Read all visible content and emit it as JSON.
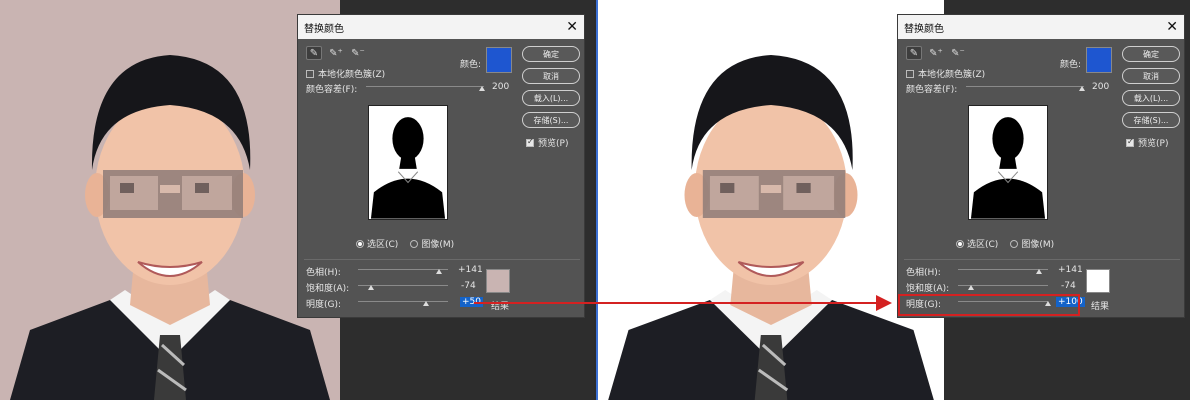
{
  "dialog": {
    "title": "替换颜色",
    "localized_label": "本地化颜色簇(Z)",
    "color_label": "颜色:",
    "fuzziness_label": "颜色容差(F):",
    "fuzziness_value": "200",
    "selection_label": "选区(C)",
    "image_label": "图像(M)",
    "hue_label": "色相(H):",
    "saturation_label": "饱和度(A):",
    "lightness_label": "明度(G):",
    "result_label": "结果",
    "buttons": {
      "ok": "确定",
      "cancel": "取消",
      "load": "载入(L)...",
      "save": "存储(S)..."
    },
    "preview_label": "预览(P)"
  },
  "left": {
    "hue": "+141",
    "saturation": "-74",
    "lightness": "+50",
    "result_color": "#c9b4b2",
    "photo_bg": "#c9b4b2"
  },
  "right": {
    "hue": "+141",
    "saturation": "-74",
    "lightness": "+100",
    "result_color": "#ffffff",
    "photo_bg": "#ffffff"
  },
  "colors": {
    "swatch": "#1e56d0",
    "highlight": "#1463c9",
    "annotation": "#d42121"
  },
  "icons": [
    "eyedropper-icon",
    "eyedropper-plus-icon",
    "eyedropper-minus-icon",
    "close-icon"
  ]
}
